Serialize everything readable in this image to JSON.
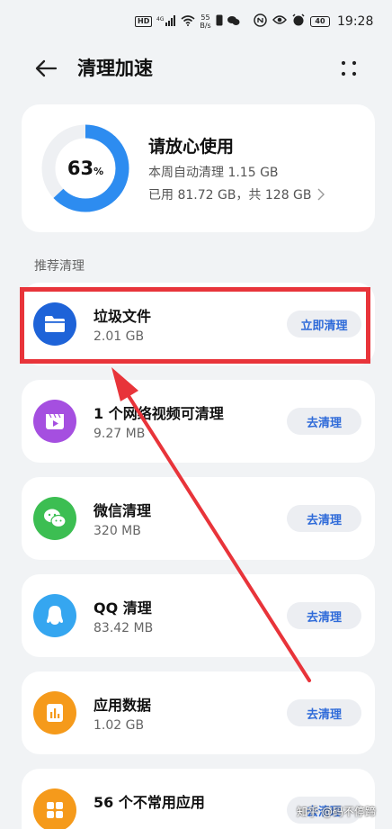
{
  "status_bar": {
    "hd": "HD",
    "signal": "4G",
    "net_speed_value": "55",
    "net_speed_unit": "B/s",
    "battery": "40",
    "time": "19:28"
  },
  "header": {
    "title": "清理加速"
  },
  "summary": {
    "percent": "63",
    "percent_sign": "%",
    "percent_value": 0.63,
    "title": "请放心使用",
    "weekly": "本周自动清理 1.15 GB",
    "storage": "已用 81.72 GB，共 128 GB",
    "ring_color": "#2d8cf0"
  },
  "section": {
    "label": "推荐清理"
  },
  "items": [
    {
      "title": "垃圾文件",
      "sub": "2.01 GB",
      "button": "立即清理",
      "icon": "folder-icon",
      "color": "#1e63d8"
    },
    {
      "title": "1 个网络视频可清理",
      "sub": "9.27 MB",
      "button": "去清理",
      "icon": "video-icon",
      "color": "#a54fe0"
    },
    {
      "title": "微信清理",
      "sub": "320 MB",
      "button": "去清理",
      "icon": "wechat-icon",
      "color": "#3cbe52"
    },
    {
      "title": "QQ 清理",
      "sub": "83.42 MB",
      "button": "去清理",
      "icon": "qq-icon",
      "color": "#35a6f0"
    },
    {
      "title": "应用数据",
      "sub": "1.02 GB",
      "button": "去清理",
      "icon": "app-data-icon",
      "color": "#f59a1b"
    },
    {
      "title": "56 个不常用应用",
      "sub": "",
      "button": "去清理",
      "icon": "apps-grid-icon",
      "color": "#f59a1b"
    }
  ],
  "watermark": "知乎 @码不停蹄",
  "annotation_color": "#e8343a"
}
